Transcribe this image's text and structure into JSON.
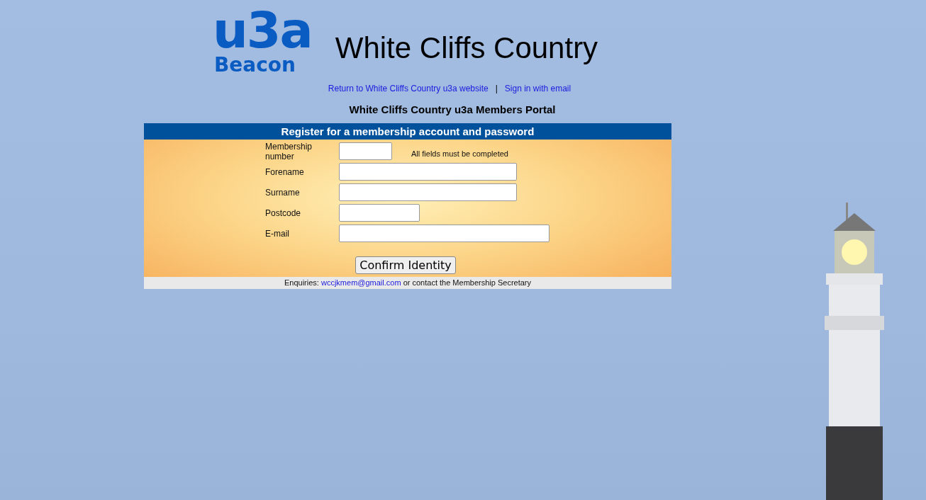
{
  "logo": {
    "mark": "u3a",
    "sub": "Beacon"
  },
  "site_title": "White Cliffs Country",
  "nav": {
    "links": [
      "Return to White Cliffs Country u3a website",
      "Sign in with email"
    ],
    "separator": "|"
  },
  "portal_title": "White Cliffs Country u3a Members Portal",
  "form": {
    "title": "Register for a membership account and password",
    "note": "All fields must be completed",
    "fields": [
      {
        "label": "Membership number",
        "kind": "number"
      },
      {
        "label": "Forename",
        "kind": "name"
      },
      {
        "label": "Surname",
        "kind": "name"
      },
      {
        "label": "Postcode",
        "kind": "postcode"
      },
      {
        "label": "E-mail",
        "kind": "email"
      }
    ],
    "button": "Confirm Identity",
    "footer": {
      "prefix": "Enquiries:",
      "email": "wccjkmem@gmail.com",
      "suffix": "or contact the Membership Secretary"
    }
  }
}
